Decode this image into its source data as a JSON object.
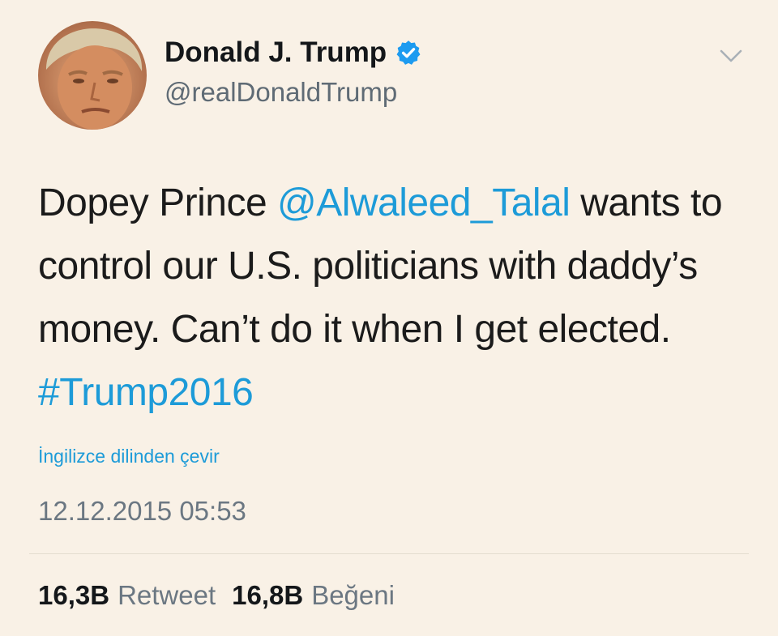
{
  "author": {
    "name": "Donald J. Trump",
    "handle": "@realDonaldTrump",
    "verified_color": "#1d9bf0"
  },
  "tweet": {
    "segments": [
      {
        "text": "Dopey Prince ",
        "type": "text"
      },
      {
        "text": "@Alwaleed_Talal",
        "type": "mention"
      },
      {
        "text": " wants to control our U.S. politicians with daddy’s money. Can’t do it when I get elected. ",
        "type": "text"
      },
      {
        "text": "#Trump2016",
        "type": "hashtag"
      }
    ]
  },
  "translate_label": "İngilizce dilinden çevir",
  "timestamp": "12.12.2015 05:53",
  "stats": {
    "retweet_count": "16,3B",
    "retweet_label": "Retweet",
    "like_count": "16,8B",
    "like_label": "Beğeni"
  },
  "colors": {
    "background": "#f9f1e6",
    "link": "#1d9bd8",
    "muted": "#6b7782"
  }
}
